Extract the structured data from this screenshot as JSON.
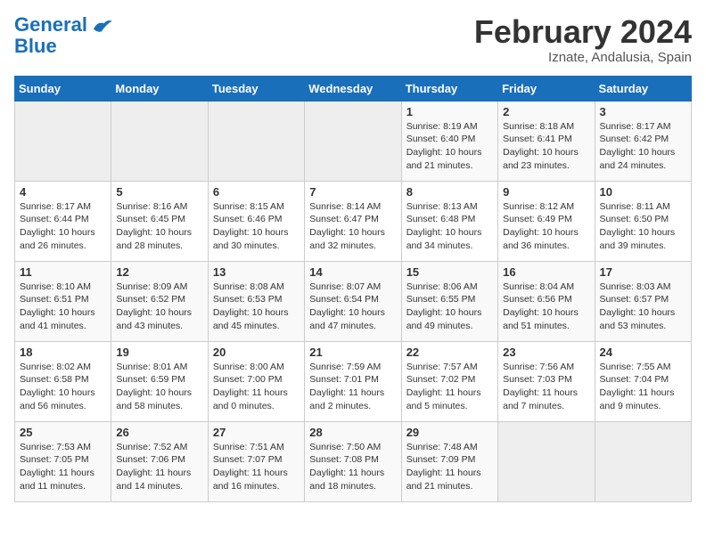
{
  "logo": {
    "part1": "General",
    "part2": "Blue"
  },
  "title": "February 2024",
  "location": "Iznate, Andalusia, Spain",
  "weekdays": [
    "Sunday",
    "Monday",
    "Tuesday",
    "Wednesday",
    "Thursday",
    "Friday",
    "Saturday"
  ],
  "weeks": [
    [
      {
        "num": "",
        "empty": true
      },
      {
        "num": "",
        "empty": true
      },
      {
        "num": "",
        "empty": true
      },
      {
        "num": "",
        "empty": true
      },
      {
        "num": "1",
        "sunrise": "8:19 AM",
        "sunset": "6:40 PM",
        "daylight": "10 hours and 21 minutes."
      },
      {
        "num": "2",
        "sunrise": "8:18 AM",
        "sunset": "6:41 PM",
        "daylight": "10 hours and 23 minutes."
      },
      {
        "num": "3",
        "sunrise": "8:17 AM",
        "sunset": "6:42 PM",
        "daylight": "10 hours and 24 minutes."
      }
    ],
    [
      {
        "num": "4",
        "sunrise": "8:17 AM",
        "sunset": "6:44 PM",
        "daylight": "10 hours and 26 minutes."
      },
      {
        "num": "5",
        "sunrise": "8:16 AM",
        "sunset": "6:45 PM",
        "daylight": "10 hours and 28 minutes."
      },
      {
        "num": "6",
        "sunrise": "8:15 AM",
        "sunset": "6:46 PM",
        "daylight": "10 hours and 30 minutes."
      },
      {
        "num": "7",
        "sunrise": "8:14 AM",
        "sunset": "6:47 PM",
        "daylight": "10 hours and 32 minutes."
      },
      {
        "num": "8",
        "sunrise": "8:13 AM",
        "sunset": "6:48 PM",
        "daylight": "10 hours and 34 minutes."
      },
      {
        "num": "9",
        "sunrise": "8:12 AM",
        "sunset": "6:49 PM",
        "daylight": "10 hours and 36 minutes."
      },
      {
        "num": "10",
        "sunrise": "8:11 AM",
        "sunset": "6:50 PM",
        "daylight": "10 hours and 39 minutes."
      }
    ],
    [
      {
        "num": "11",
        "sunrise": "8:10 AM",
        "sunset": "6:51 PM",
        "daylight": "10 hours and 41 minutes."
      },
      {
        "num": "12",
        "sunrise": "8:09 AM",
        "sunset": "6:52 PM",
        "daylight": "10 hours and 43 minutes."
      },
      {
        "num": "13",
        "sunrise": "8:08 AM",
        "sunset": "6:53 PM",
        "daylight": "10 hours and 45 minutes."
      },
      {
        "num": "14",
        "sunrise": "8:07 AM",
        "sunset": "6:54 PM",
        "daylight": "10 hours and 47 minutes."
      },
      {
        "num": "15",
        "sunrise": "8:06 AM",
        "sunset": "6:55 PM",
        "daylight": "10 hours and 49 minutes."
      },
      {
        "num": "16",
        "sunrise": "8:04 AM",
        "sunset": "6:56 PM",
        "daylight": "10 hours and 51 minutes."
      },
      {
        "num": "17",
        "sunrise": "8:03 AM",
        "sunset": "6:57 PM",
        "daylight": "10 hours and 53 minutes."
      }
    ],
    [
      {
        "num": "18",
        "sunrise": "8:02 AM",
        "sunset": "6:58 PM",
        "daylight": "10 hours and 56 minutes."
      },
      {
        "num": "19",
        "sunrise": "8:01 AM",
        "sunset": "6:59 PM",
        "daylight": "10 hours and 58 minutes."
      },
      {
        "num": "20",
        "sunrise": "8:00 AM",
        "sunset": "7:00 PM",
        "daylight": "11 hours and 0 minutes."
      },
      {
        "num": "21",
        "sunrise": "7:59 AM",
        "sunset": "7:01 PM",
        "daylight": "11 hours and 2 minutes."
      },
      {
        "num": "22",
        "sunrise": "7:57 AM",
        "sunset": "7:02 PM",
        "daylight": "11 hours and 5 minutes."
      },
      {
        "num": "23",
        "sunrise": "7:56 AM",
        "sunset": "7:03 PM",
        "daylight": "11 hours and 7 minutes."
      },
      {
        "num": "24",
        "sunrise": "7:55 AM",
        "sunset": "7:04 PM",
        "daylight": "11 hours and 9 minutes."
      }
    ],
    [
      {
        "num": "25",
        "sunrise": "7:53 AM",
        "sunset": "7:05 PM",
        "daylight": "11 hours and 11 minutes."
      },
      {
        "num": "26",
        "sunrise": "7:52 AM",
        "sunset": "7:06 PM",
        "daylight": "11 hours and 14 minutes."
      },
      {
        "num": "27",
        "sunrise": "7:51 AM",
        "sunset": "7:07 PM",
        "daylight": "11 hours and 16 minutes."
      },
      {
        "num": "28",
        "sunrise": "7:50 AM",
        "sunset": "7:08 PM",
        "daylight": "11 hours and 18 minutes."
      },
      {
        "num": "29",
        "sunrise": "7:48 AM",
        "sunset": "7:09 PM",
        "daylight": "11 hours and 21 minutes."
      },
      {
        "num": "",
        "empty": true
      },
      {
        "num": "",
        "empty": true
      }
    ]
  ]
}
